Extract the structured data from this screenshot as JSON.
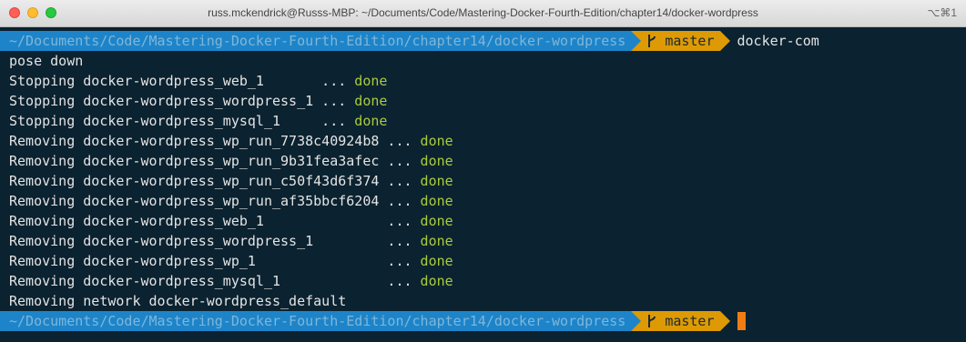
{
  "window": {
    "title": "russ.mckendrick@Russs-MBP: ~/Documents/Code/Mastering-Docker-Fourth-Edition/chapter14/docker-wordpress",
    "shortcut": "⌥⌘1"
  },
  "prompt": {
    "path": "~/Documents/Code/Mastering-Docker-Fourth-Edition/chapter14/docker-wordpress",
    "branch": "master",
    "command_start": "docker-com"
  },
  "output": [
    {
      "text": "pose down",
      "status": ""
    },
    {
      "text": "Stopping docker-wordpress_web_1       ... ",
      "status": "done"
    },
    {
      "text": "Stopping docker-wordpress_wordpress_1 ... ",
      "status": "done"
    },
    {
      "text": "Stopping docker-wordpress_mysql_1     ... ",
      "status": "done"
    },
    {
      "text": "Removing docker-wordpress_wp_run_7738c40924b8 ... ",
      "status": "done"
    },
    {
      "text": "Removing docker-wordpress_wp_run_9b31fea3afec ... ",
      "status": "done"
    },
    {
      "text": "Removing docker-wordpress_wp_run_c50f43d6f374 ... ",
      "status": "done"
    },
    {
      "text": "Removing docker-wordpress_wp_run_af35bbcf6204 ... ",
      "status": "done"
    },
    {
      "text": "Removing docker-wordpress_web_1               ... ",
      "status": "done"
    },
    {
      "text": "Removing docker-wordpress_wordpress_1         ... ",
      "status": "done"
    },
    {
      "text": "Removing docker-wordpress_wp_1                ... ",
      "status": "done"
    },
    {
      "text": "Removing docker-wordpress_mysql_1             ... ",
      "status": "done"
    },
    {
      "text": "Removing network docker-wordpress_default",
      "status": ""
    }
  ],
  "prompt2": {
    "path": "~/Documents/Code/Mastering-Docker-Fourth-Edition/chapter14/docker-wordpress",
    "branch": "master"
  },
  "colors": {
    "background": "#0b2230",
    "path_segment": "#1d84c9",
    "git_segment": "#dd9a04",
    "done": "#a9cc3c",
    "cursor": "#f07d14"
  }
}
